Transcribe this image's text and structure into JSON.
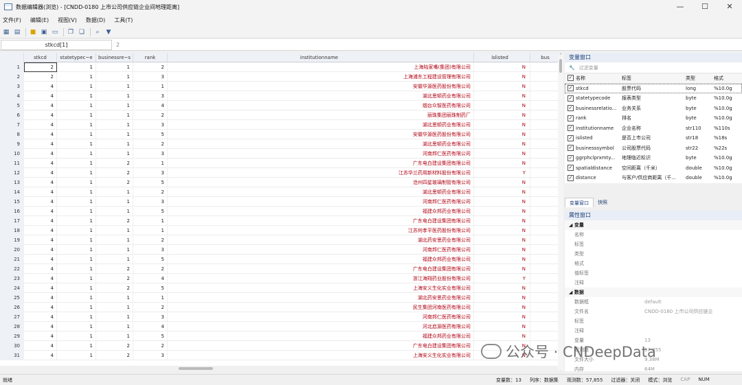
{
  "window": {
    "title": "数据编辑器(浏览) - [CNDD-0180 上市公司供应链企业间地理距离]",
    "minimize": "—",
    "maximize": "☐",
    "close": "✕"
  },
  "menu": [
    "文件(F)",
    "编辑(E)",
    "视图(V)",
    "数据(D)",
    "工具(T)"
  ],
  "cellbar": {
    "name": "stkcd[1]",
    "value": "2"
  },
  "columns": [
    "stkcd",
    "statetypec~e",
    "businessre~s",
    "rank",
    "institutionname",
    "islisted",
    "bus"
  ],
  "rows": [
    [
      "1",
      "2",
      "1",
      "1",
      "2",
      "上海陆家嘴(集团)有限公司",
      "N"
    ],
    [
      "2",
      "2",
      "1",
      "1",
      "3",
      "上海浦东工程建设管理有限公司",
      "N"
    ],
    [
      "3",
      "4",
      "1",
      "1",
      "1",
      "安徽华源医药股份有限公司",
      "N"
    ],
    [
      "4",
      "4",
      "1",
      "1",
      "3",
      "湖北思顿药业有限公司",
      "N"
    ],
    [
      "5",
      "4",
      "1",
      "1",
      "4",
      "烟台众智医药有限公司",
      "N"
    ],
    [
      "6",
      "4",
      "1",
      "1",
      "2",
      "丽珠集团丽珠制药厂",
      "N"
    ],
    [
      "7",
      "4",
      "1",
      "1",
      "3",
      "湖北思顿药业有限公司",
      "N"
    ],
    [
      "8",
      "4",
      "1",
      "1",
      "5",
      "安徽华源医药股份有限公司",
      "N"
    ],
    [
      "9",
      "4",
      "1",
      "1",
      "2",
      "湖北思顿药业有限公司",
      "N"
    ],
    [
      "10",
      "4",
      "1",
      "1",
      "3",
      "河南邦仁医药有限公司",
      "N"
    ],
    [
      "11",
      "4",
      "1",
      "2",
      "1",
      "广东电白建设集团有限公司",
      "N"
    ],
    [
      "12",
      "4",
      "1",
      "2",
      "3",
      "江苏华兰药用新材料股份有限公司",
      "Y"
    ],
    [
      "13",
      "4",
      "1",
      "2",
      "5",
      "沧州四星玻璃制管有限公司",
      "N"
    ],
    [
      "14",
      "4",
      "1",
      "1",
      "2",
      "湖北思顿药业有限公司",
      "N"
    ],
    [
      "15",
      "4",
      "1",
      "1",
      "3",
      "河南邦仁医药有限公司",
      "N"
    ],
    [
      "16",
      "4",
      "1",
      "1",
      "5",
      "福建众邦药业有限公司",
      "N"
    ],
    [
      "17",
      "4",
      "1",
      "2",
      "1",
      "广东电白建设集团有限公司",
      "N"
    ],
    [
      "18",
      "4",
      "1",
      "1",
      "1",
      "江苏何孝平医药股份有限公司",
      "N"
    ],
    [
      "19",
      "4",
      "1",
      "1",
      "2",
      "湖北药安思药业有限公司",
      "N"
    ],
    [
      "20",
      "4",
      "1",
      "1",
      "3",
      "河南邦仁医药有限公司",
      "N"
    ],
    [
      "21",
      "4",
      "1",
      "1",
      "5",
      "福建众邦药业有限公司",
      "N"
    ],
    [
      "22",
      "4",
      "1",
      "2",
      "2",
      "广东电白建设集团有限公司",
      "N"
    ],
    [
      "23",
      "4",
      "1",
      "2",
      "4",
      "浙江海翔药业股份有限公司",
      "Y"
    ],
    [
      "24",
      "4",
      "1",
      "2",
      "5",
      "上海安义生化实业有限公司",
      "N"
    ],
    [
      "25",
      "4",
      "1",
      "1",
      "1",
      "湖北药安思药业有限公司",
      "N"
    ],
    [
      "26",
      "4",
      "1",
      "1",
      "2",
      "民生集团河南医药有限公司",
      "N"
    ],
    [
      "27",
      "4",
      "1",
      "1",
      "3",
      "河南邦仁医药有限公司",
      "N"
    ],
    [
      "28",
      "4",
      "1",
      "1",
      "4",
      "河北启源医药有限公司",
      "N"
    ],
    [
      "29",
      "4",
      "1",
      "1",
      "5",
      "福建众邦药业有限公司",
      "N"
    ],
    [
      "30",
      "4",
      "1",
      "2",
      "2",
      "广东电白建设集团有限公司",
      "N"
    ],
    [
      "31",
      "4",
      "1",
      "2",
      "3",
      "上海安义生化实业有限公司",
      "N"
    ]
  ],
  "varpanel": {
    "title": "变量窗口",
    "filter_placeholder": "过滤变量",
    "headers": [
      "名称",
      "标签",
      "类型",
      "格式"
    ],
    "vars": [
      [
        "stkcd",
        "股票代码",
        "long",
        "%10.0g"
      ],
      [
        "statetypecode",
        "报表类型",
        "byte",
        "%10.0g"
      ],
      [
        "businessrelatio...",
        "业务关系",
        "byte",
        "%10.0g"
      ],
      [
        "rank",
        "排名",
        "byte",
        "%10.0g"
      ],
      [
        "institutionname",
        "企业名称",
        "str110",
        "%110s"
      ],
      [
        "islisted",
        "是否上市公司",
        "str18",
        "%18s"
      ],
      [
        "businesssymbol",
        "公司股票代码",
        "str22",
        "%22s"
      ],
      [
        "ggrphclprxmty...",
        "地理临近标识",
        "byte",
        "%10.0g"
      ],
      [
        "spatialdistance",
        "空间距离（千米）",
        "double",
        "%10.0g"
      ],
      [
        "distance",
        "与客户/供应商距离（千...",
        "double",
        "%10.0g"
      ]
    ]
  },
  "tabs": [
    "变量窗口",
    "快照"
  ],
  "props": {
    "title": "属性窗口",
    "var_section": "变量",
    "var_rows": [
      "名称",
      "标签",
      "类型",
      "格式",
      "值标签",
      "注释"
    ],
    "data_section": "数据",
    "data_rows": [
      [
        "数据框",
        "default"
      ],
      [
        "文件名",
        "CNDD-0180 上市公司供应链企"
      ],
      [
        "标签",
        ""
      ],
      [
        "注释",
        ""
      ],
      [
        "变量",
        "13"
      ],
      [
        "观测数",
        "57,855"
      ],
      [
        "文件大小",
        "9.38M"
      ],
      [
        "内存",
        "64M"
      ]
    ]
  },
  "status": {
    "ready": "就绪",
    "vars": "变量数：13",
    "order": "列序：数据集",
    "obs": "观测数：57,855",
    "filter": "过滤器：关闭",
    "mode": "模式：浏览",
    "cap": "CAP",
    "num": "NUM"
  },
  "watermark": "公众号 · CNDeepData"
}
